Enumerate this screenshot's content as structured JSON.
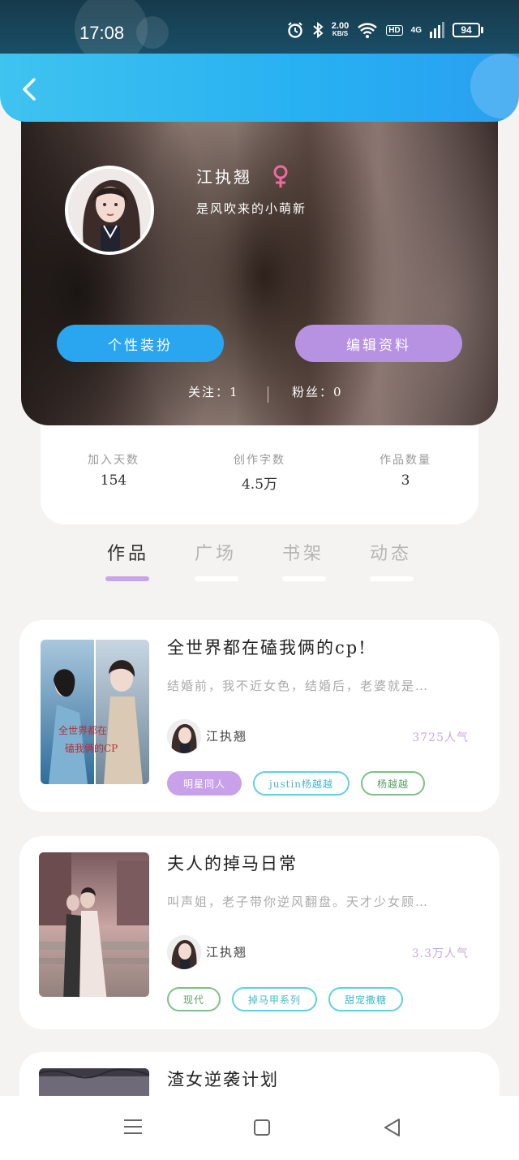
{
  "status_bar": {
    "time": "17:08",
    "net_speed_value": "2.00",
    "net_speed_unit": "KB/S",
    "hd_label": "HD",
    "network": "4G",
    "battery": "94"
  },
  "profile": {
    "name": "江执翘",
    "bio": "是风吹来的小萌新",
    "dress_button": "个性装扮",
    "edit_button": "编辑资料",
    "following": "关注：1",
    "followers": "粉丝：0"
  },
  "stats": [
    {
      "label": "加入天数",
      "value": "154"
    },
    {
      "label": "创作字数",
      "value": "4.5万"
    },
    {
      "label": "作品数量",
      "value": "3"
    }
  ],
  "tabs": [
    {
      "label": "作品",
      "active": true
    },
    {
      "label": "广场",
      "active": false
    },
    {
      "label": "书架",
      "active": false
    },
    {
      "label": "动态",
      "active": false
    }
  ],
  "works": [
    {
      "title": "全世界都在磕我俩的cp!",
      "desc": "结婚前，我不近女色，结婚后，老婆就是…",
      "author": "江执翘",
      "popularity": "3725人气",
      "tags": [
        {
          "label": "明星同人",
          "style": "purple"
        },
        {
          "label": "justin杨越越",
          "style": "cyan"
        },
        {
          "label": "杨越越",
          "style": "green"
        }
      ]
    },
    {
      "title": "夫人的掉马日常",
      "desc": "叫声姐，老子带你逆风翻盘。天才少女顾…",
      "author": "江执翘",
      "popularity": "3.3万人气",
      "tags": [
        {
          "label": "现代",
          "style": "green"
        },
        {
          "label": "掉马甲系列",
          "style": "cyan"
        },
        {
          "label": "甜宠撒糖",
          "style": "cyan"
        }
      ]
    },
    {
      "title": "渣女逆袭计划"
    }
  ],
  "colors": {
    "topbar": "#29b0f2",
    "dress_button": "#2aa6f0",
    "edit_button": "#b892e2",
    "tab_indicator": "#c6a5ea",
    "popularity": "#c9a7e6"
  }
}
